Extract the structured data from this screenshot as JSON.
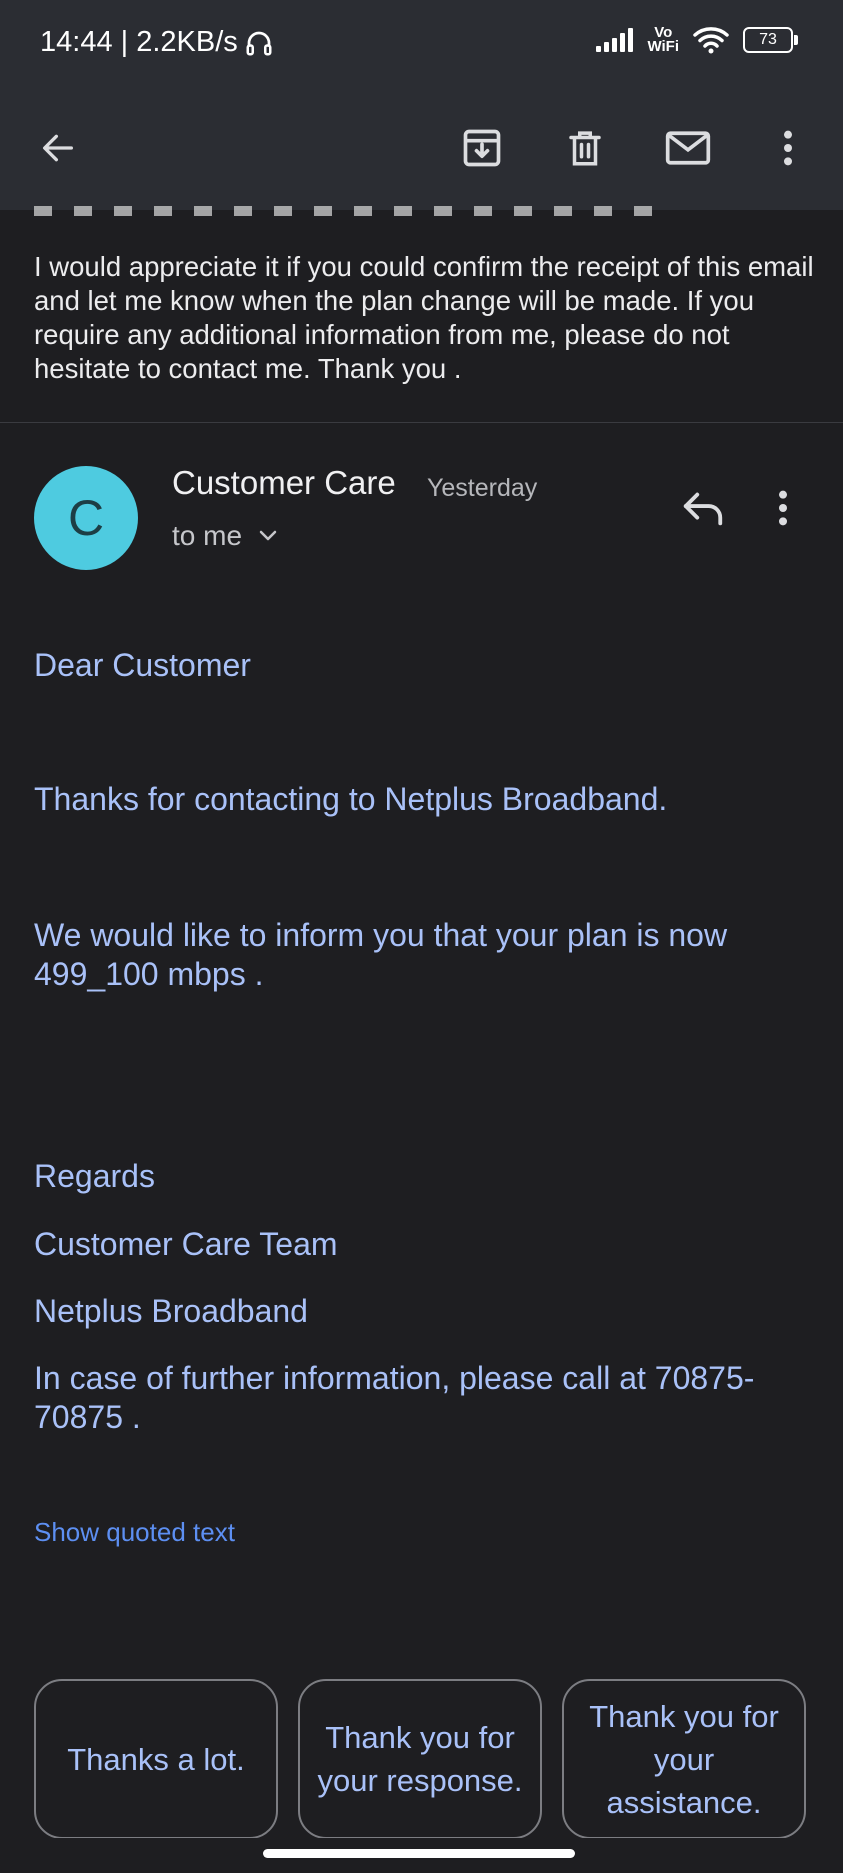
{
  "status_bar": {
    "time": "14:44 | 2.2KB/s",
    "vowifi_line1": "Vo",
    "vowifi_line2": "WiFi",
    "battery": "73"
  },
  "toolbar": {
    "back_icon": "arrow-left-icon",
    "archive_icon": "archive-icon",
    "delete_icon": "trash-icon",
    "mark_unread_icon": "mail-icon",
    "more_icon": "more-vertical-icon"
  },
  "previous_message": {
    "body": "I would appreciate it if you could confirm the receipt of this email and let me know when the plan change will be made. If you require any additional information from me, please do not hesitate to contact me. Thank you ."
  },
  "message": {
    "avatar_letter": "C",
    "sender": "Customer Care",
    "time": "Yesterday",
    "recipient": "to me",
    "greeting": "Dear Customer",
    "line1": "Thanks for contacting to Netplus Broadband.",
    "line2": "We would like to inform you that your plan is now 499_100 mbps .",
    "regards": "Regards",
    "team": "Customer Care Team",
    "company": "Netplus Broadband",
    "contact": "In case of further information, please call at 70875-70875 .",
    "show_quoted": "Show quoted text"
  },
  "smart_replies": [
    "Thanks a lot.",
    "Thank you for your response.",
    "Thank you for your assistance."
  ],
  "colors": {
    "avatar": "#4ecbe0",
    "body_text": "#a9c1f8",
    "link": "#5d8ff2"
  }
}
